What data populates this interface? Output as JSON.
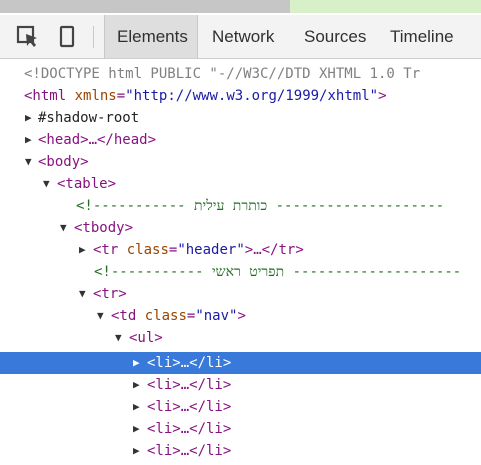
{
  "toolbar": {
    "tabs": [
      {
        "label": "Elements",
        "active": true
      },
      {
        "label": "Network",
        "active": false
      },
      {
        "label": "Sources",
        "active": false
      },
      {
        "label": "Timeline",
        "active": false
      }
    ],
    "icons": [
      "inspect-element-icon",
      "device-mode-icon"
    ]
  },
  "tree": {
    "doctype": "<!DOCTYPE html PUBLIC \"-//W3C//DTD XHTML 1.0 Tr",
    "html_open": "<html",
    "html_attr": "xmlns",
    "html_val": "\"http://www.w3.org/1999/xhtml\"",
    "html_close": ">",
    "shadow_root": "#shadow-root",
    "head": "<head>…</head>",
    "body": "<body>",
    "table": "<table>",
    "comment1": "<!----------- כותרת עילית --------------------",
    "tbody": "<tbody>",
    "tr_open": "<tr",
    "tr_attr": "class",
    "tr_val": "\"header\"",
    "tr_close": ">…</tr>",
    "comment2": "<!----------- תפריט ראשי --------------------",
    "tr2": "<tr>",
    "td_open": "<td",
    "td_attr": "class",
    "td_val": "\"nav\"",
    "td_close": ">",
    "ul": "<ul>",
    "li_items": [
      "<li>…</li>",
      "<li>…</li>",
      "<li>…</li>",
      "<li>…</li>",
      "<li>…</li>"
    ]
  },
  "colors": {
    "selection": "#3879d9",
    "tag": "#881280",
    "attribute": "#994500",
    "value": "#1a1aa6",
    "comment": "#236e25"
  }
}
